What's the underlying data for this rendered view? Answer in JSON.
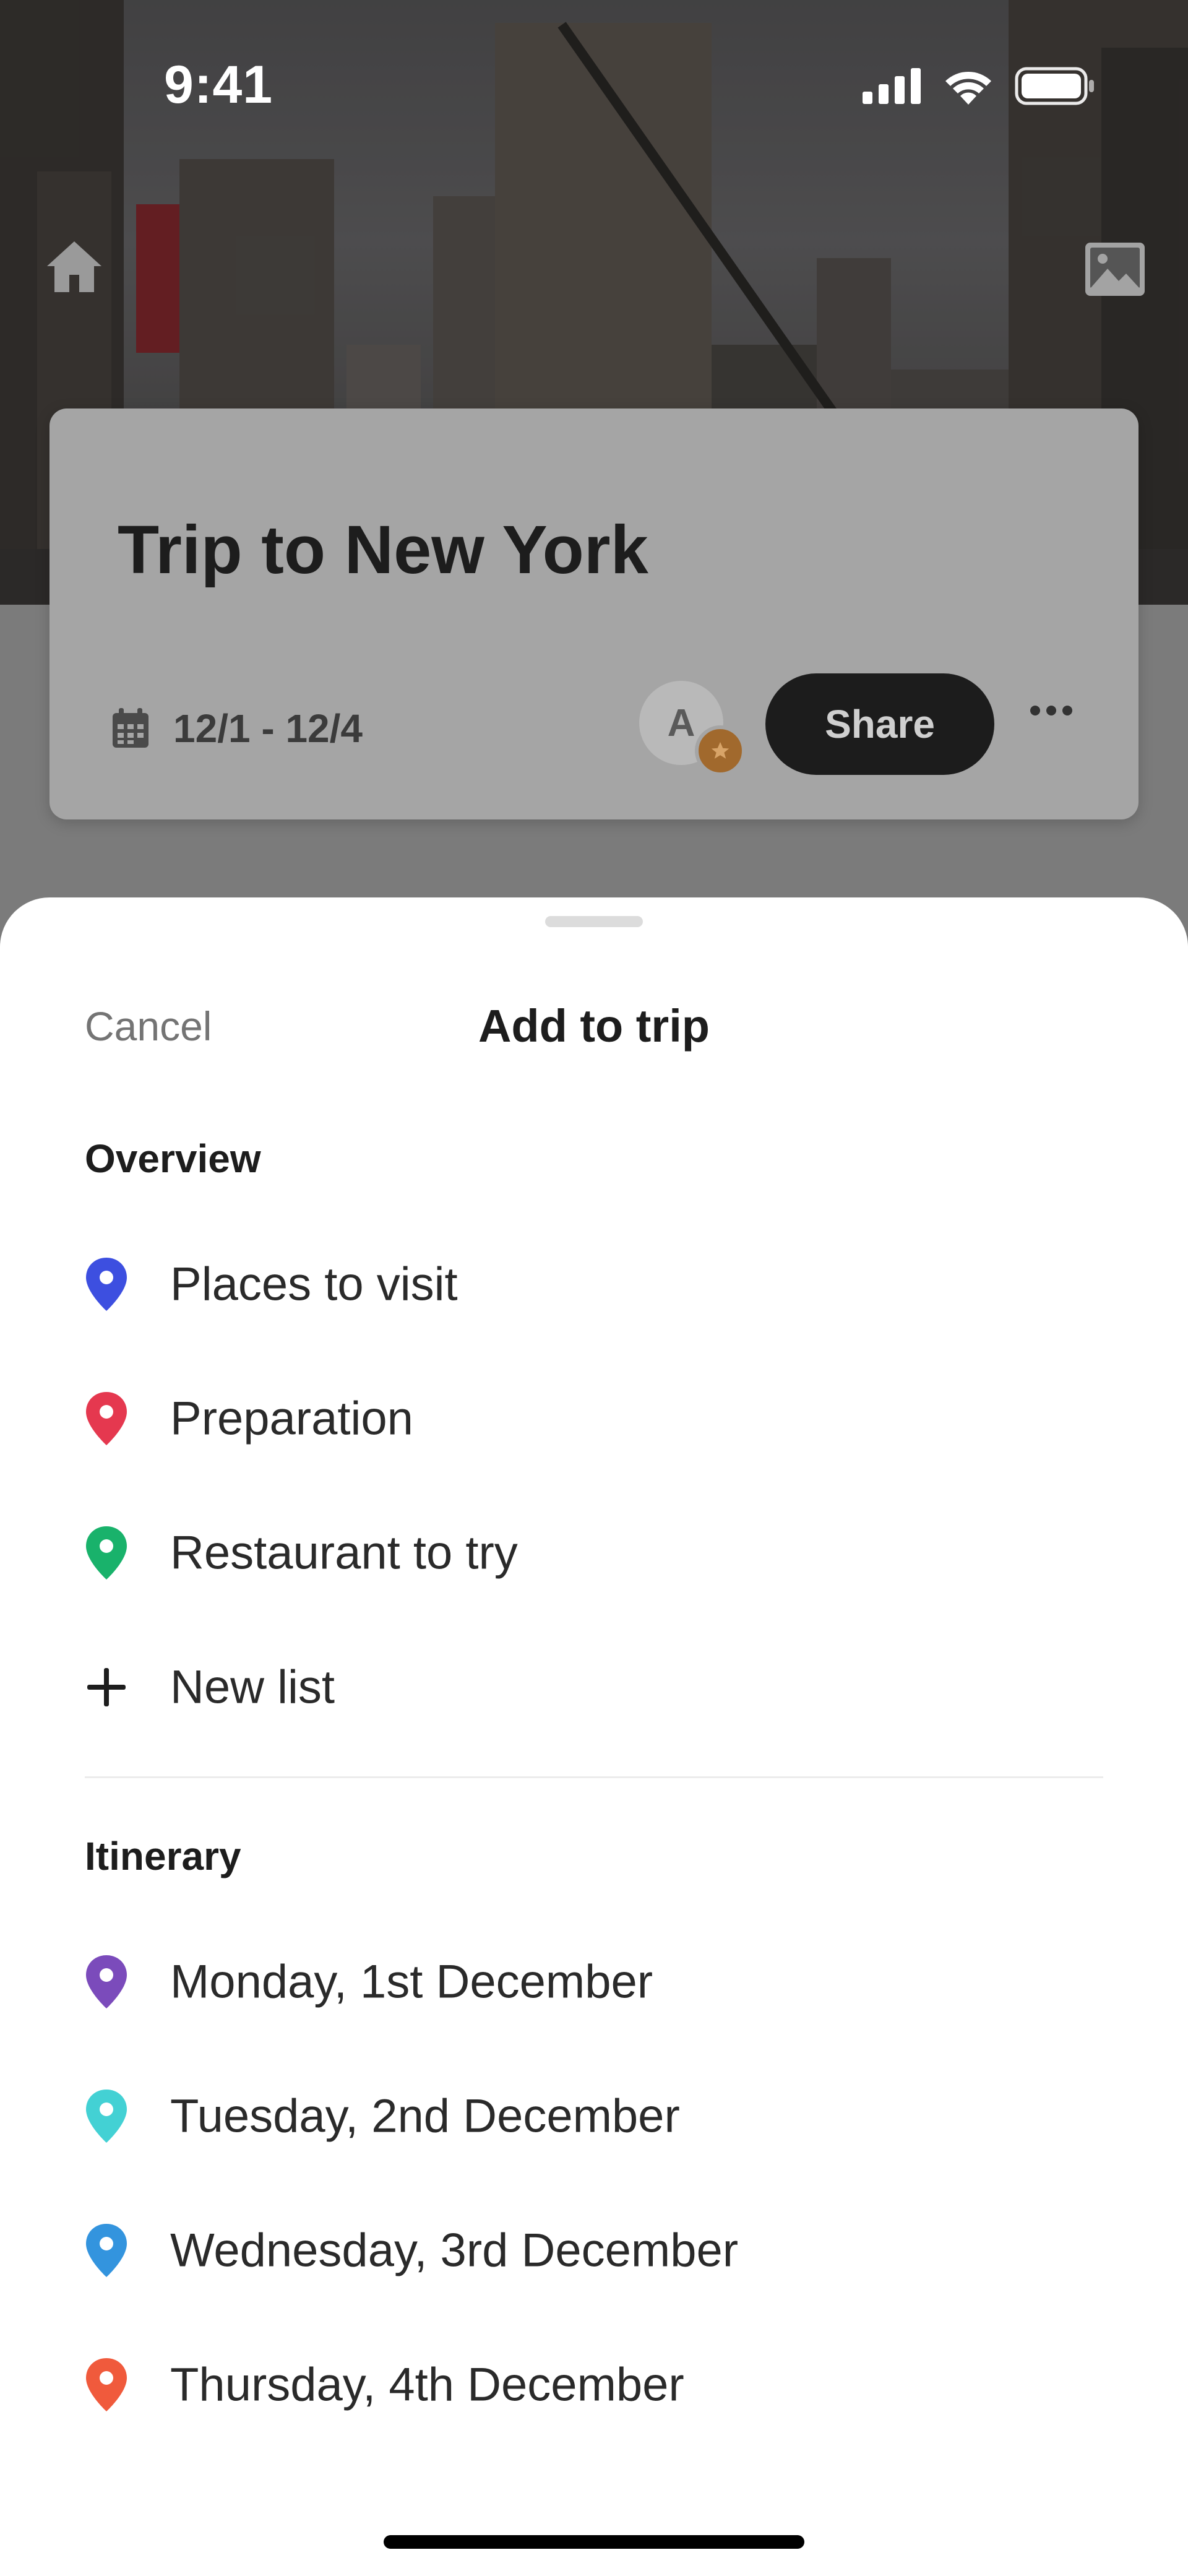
{
  "status_bar": {
    "time": "9:41"
  },
  "header": {
    "home_icon": "home-icon",
    "image_icon": "image-icon"
  },
  "trip": {
    "title": "Trip to New York",
    "dates": "12/1 - 12/4",
    "avatar_initial": "A",
    "share_label": "Share"
  },
  "sheet": {
    "cancel_label": "Cancel",
    "title": "Add to trip",
    "overview": {
      "heading": "Overview",
      "items": [
        {
          "label": "Places to visit",
          "color": "#3d4fe0"
        },
        {
          "label": "Preparation",
          "color": "#e5384f"
        },
        {
          "label": "Restaurant to try",
          "color": "#19b26b"
        }
      ],
      "new_list_label": "New list"
    },
    "itinerary": {
      "heading": "Itinerary",
      "items": [
        {
          "label": "Monday, 1st December",
          "color": "#7b4bbb"
        },
        {
          "label": "Tuesday, 2nd December",
          "color": "#43d1d4"
        },
        {
          "label": "Wednesday, 3rd December",
          "color": "#3394de"
        },
        {
          "label": "Thursday, 4th December",
          "color": "#f05a3c"
        }
      ]
    }
  }
}
